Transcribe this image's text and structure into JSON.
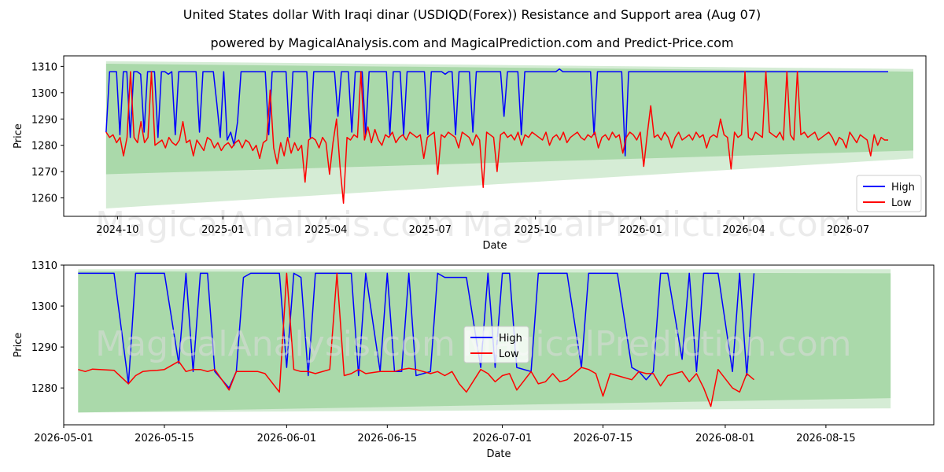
{
  "title": "United States dollar With Iraqi dinar (USDIQD(Forex)) Resistance and Support area (Aug 07)",
  "subtitle": "powered by MagicalAnalysis.com and MagicalPrediction.com and Predict-Price.com",
  "watermarks": [
    "MagicalAnalysis.com",
    "MagicalPrediction.com"
  ],
  "colors": {
    "high": "#0000ff",
    "low": "#ff0000",
    "band": "#2ca02c"
  },
  "chart_data": [
    {
      "type": "line",
      "xlabel": "Date",
      "ylabel": "Price",
      "xlim": [
        "2024-08-15",
        "2026-09-07"
      ],
      "ylim": [
        1253,
        1314
      ],
      "x_ticks": [
        "2024-10",
        "2025-01",
        "2025-04",
        "2025-07",
        "2025-10",
        "2026-01",
        "2026-04",
        "2026-07"
      ],
      "x_tick_dates": [
        "2024-10-01",
        "2025-01-01",
        "2025-04-01",
        "2025-07-01",
        "2025-10-01",
        "2026-01-01",
        "2026-04-01",
        "2026-07-01"
      ],
      "y_ticks": [
        1260,
        1270,
        1280,
        1290,
        1300,
        1310
      ],
      "legend": {
        "position": "lower right",
        "entries": [
          "High",
          "Low"
        ]
      },
      "bands": [
        {
          "x": [
            "2024-09-21",
            "2026-08-27"
          ],
          "upper": [
            1312,
            1309
          ],
          "lower": [
            1256,
            1275
          ],
          "opacity": 0.2
        },
        {
          "x": [
            "2024-09-21",
            "2026-08-27"
          ],
          "upper": [
            1311,
            1308
          ],
          "lower": [
            1269,
            1278
          ],
          "opacity": 0.25
        }
      ],
      "series": [
        {
          "name": "High",
          "start": "2024-09-21",
          "end": "2026-08-05",
          "values": [
            1285,
            1308,
            1308,
            1308,
            1284,
            1308,
            1308,
            1283,
            1308,
            1308,
            1307,
            1285,
            1308,
            1308,
            1308,
            1283,
            1308,
            1308,
            1307,
            1308,
            1284,
            1308,
            1308,
            1308,
            1308,
            1308,
            1308,
            1285,
            1308,
            1308,
            1308,
            1308,
            1296,
            1283,
            1308,
            1282,
            1285,
            1280,
            1289,
            1308,
            1308,
            1308,
            1308,
            1308,
            1308,
            1308,
            1308,
            1284,
            1308,
            1308,
            1308,
            1308,
            1308,
            1283,
            1308,
            1308,
            1308,
            1308,
            1308,
            1283,
            1308,
            1308,
            1308,
            1308,
            1308,
            1308,
            1308,
            1291,
            1308,
            1308,
            1308,
            1285,
            1308,
            1308,
            1308,
            1284,
            1308,
            1308,
            1308,
            1308,
            1308,
            1308,
            1284,
            1308,
            1308,
            1308,
            1284,
            1308,
            1308,
            1308,
            1308,
            1308,
            1308,
            1284,
            1308,
            1308,
            1308,
            1308,
            1307,
            1308,
            1308,
            1284,
            1308,
            1308,
            1308,
            1308,
            1285,
            1308,
            1308,
            1308,
            1308,
            1308,
            1308,
            1308,
            1308,
            1291,
            1308,
            1308,
            1308,
            1308,
            1284,
            1308,
            1308,
            1308,
            1308,
            1308,
            1308,
            1308,
            1308,
            1308,
            1308,
            1309,
            1308,
            1308,
            1308,
            1308,
            1308,
            1308,
            1308,
            1308,
            1308,
            1284,
            1308,
            1308,
            1308,
            1308,
            1308,
            1308,
            1308,
            1308,
            1276,
            1308,
            1308,
            1308,
            1308,
            1308,
            1308,
            1308,
            1308,
            1308,
            1308,
            1308,
            1308,
            1308,
            1308,
            1308,
            1308,
            1308,
            1308,
            1308,
            1308,
            1308,
            1308,
            1308,
            1308,
            1308,
            1308,
            1308,
            1308,
            1308,
            1308,
            1308,
            1308,
            1308,
            1308,
            1308,
            1308,
            1308,
            1308,
            1308,
            1308,
            1308,
            1308,
            1308,
            1308,
            1308,
            1308,
            1308,
            1308,
            1308,
            1308,
            1308,
            1308,
            1308,
            1308,
            1308,
            1308,
            1308,
            1308,
            1308,
            1308,
            1308,
            1308,
            1308,
            1308,
            1308,
            1308,
            1308,
            1308,
            1308,
            1308,
            1308,
            1308,
            1308,
            1308,
            1308,
            1308
          ]
        },
        {
          "name": "Low",
          "start": "2024-09-21",
          "end": "2026-08-05",
          "values": [
            1285,
            1283,
            1284,
            1281,
            1283,
            1276,
            1283,
            1308,
            1283,
            1281,
            1289,
            1281,
            1283,
            1308,
            1280,
            1281,
            1282,
            1279,
            1283,
            1281,
            1280,
            1282,
            1289,
            1281,
            1282,
            1276,
            1282,
            1280,
            1278,
            1283,
            1282,
            1279,
            1281,
            1278,
            1280,
            1281,
            1279,
            1281,
            1282,
            1279,
            1282,
            1281,
            1278,
            1280,
            1275,
            1281,
            1282,
            1301,
            1279,
            1273,
            1281,
            1276,
            1283,
            1277,
            1281,
            1278,
            1280,
            1266,
            1282,
            1283,
            1282,
            1279,
            1283,
            1281,
            1269,
            1281,
            1290,
            1272,
            1258,
            1283,
            1282,
            1284,
            1283,
            1308,
            1282,
            1287,
            1281,
            1286,
            1282,
            1280,
            1284,
            1283,
            1285,
            1281,
            1283,
            1284,
            1282,
            1285,
            1284,
            1283,
            1284,
            1275,
            1283,
            1284,
            1285,
            1269,
            1284,
            1283,
            1285,
            1284,
            1283,
            1279,
            1285,
            1284,
            1283,
            1280,
            1284,
            1282,
            1264,
            1285,
            1284,
            1283,
            1270,
            1284,
            1285,
            1283,
            1284,
            1282,
            1285,
            1280,
            1284,
            1283,
            1285,
            1284,
            1283,
            1282,
            1285,
            1280,
            1283,
            1284,
            1282,
            1285,
            1281,
            1283,
            1284,
            1285,
            1283,
            1282,
            1284,
            1283,
            1285,
            1279,
            1283,
            1284,
            1282,
            1285,
            1283,
            1284,
            1277,
            1283,
            1285,
            1284,
            1282,
            1285,
            1272,
            1284,
            1295,
            1283,
            1284,
            1282,
            1285,
            1283,
            1279,
            1283,
            1285,
            1282,
            1283,
            1284,
            1282,
            1285,
            1283,
            1284,
            1279,
            1283,
            1284,
            1283,
            1290,
            1284,
            1283,
            1271,
            1285,
            1283,
            1284,
            1308,
            1283,
            1282,
            1285,
            1284,
            1283,
            1308,
            1285,
            1284,
            1283,
            1285,
            1282,
            1308,
            1284,
            1282,
            1308,
            1284,
            1285,
            1283,
            1284,
            1285,
            1282,
            1283,
            1284,
            1285,
            1283,
            1280,
            1283,
            1282,
            1279,
            1285,
            1283,
            1281,
            1284,
            1283,
            1282,
            1276,
            1284,
            1280,
            1283,
            1282,
            1282
          ]
        }
      ]
    },
    {
      "type": "line",
      "xlabel": "Date",
      "ylabel": "Price",
      "xlim": [
        "2026-05-01",
        "2026-08-30"
      ],
      "ylim": [
        1271,
        1310
      ],
      "x_ticks": [
        "2026-05-01",
        "2026-05-15",
        "2026-06-01",
        "2026-06-15",
        "2026-07-01",
        "2026-07-15",
        "2026-08-01",
        "2026-08-15"
      ],
      "y_ticks": [
        1280,
        1290,
        1300,
        1310
      ],
      "legend": {
        "position": "center",
        "entries": [
          "High",
          "Low"
        ]
      },
      "bands": [
        {
          "x": [
            "2026-05-03",
            "2026-08-24"
          ],
          "upper": [
            1309,
            1309
          ],
          "lower": [
            1274,
            1275
          ],
          "opacity": 0.2
        },
        {
          "x": [
            "2026-05-03",
            "2026-08-24"
          ],
          "upper": [
            1308.5,
            1308
          ],
          "lower": [
            1274,
            1277.5
          ],
          "opacity": 0.25
        }
      ],
      "series": [
        {
          "name": "High",
          "x": [
            "2026-05-03",
            "2026-05-04",
            "2026-05-05",
            "2026-05-06",
            "2026-05-07",
            "2026-05-08",
            "2026-05-10",
            "2026-05-11",
            "2026-05-12",
            "2026-05-13",
            "2026-05-14",
            "2026-05-15",
            "2026-05-17",
            "2026-05-18",
            "2026-05-19",
            "2026-05-20",
            "2026-05-21",
            "2026-05-22",
            "2026-05-24",
            "2026-05-25",
            "2026-05-26",
            "2026-05-27",
            "2026-05-28",
            "2026-05-29",
            "2026-05-31",
            "2026-06-01",
            "2026-06-02",
            "2026-06-03",
            "2026-06-04",
            "2026-06-05",
            "2026-06-07",
            "2026-06-08",
            "2026-06-09",
            "2026-06-10",
            "2026-06-11",
            "2026-06-12",
            "2026-06-14",
            "2026-06-15",
            "2026-06-16",
            "2026-06-17",
            "2026-06-18",
            "2026-06-19",
            "2026-06-21",
            "2026-06-22",
            "2026-06-23",
            "2026-06-24",
            "2026-06-25",
            "2026-06-26",
            "2026-06-28",
            "2026-06-29",
            "2026-06-30",
            "2026-07-01",
            "2026-07-02",
            "2026-07-03",
            "2026-07-05",
            "2026-07-06",
            "2026-07-07",
            "2026-07-08",
            "2026-07-09",
            "2026-07-10",
            "2026-07-12",
            "2026-07-13",
            "2026-07-14",
            "2026-07-15",
            "2026-07-16",
            "2026-07-17",
            "2026-07-19",
            "2026-07-20",
            "2026-07-21",
            "2026-07-22",
            "2026-07-23",
            "2026-07-24",
            "2026-07-26",
            "2026-07-27",
            "2026-07-28",
            "2026-07-29",
            "2026-07-30",
            "2026-07-31",
            "2026-08-02",
            "2026-08-03",
            "2026-08-04",
            "2026-08-05"
          ],
          "values": [
            1308,
            1308,
            1308,
            1308,
            1308,
            1308,
            1281,
            1308,
            1308,
            1308,
            1308,
            1308,
            1286,
            1308,
            1284,
            1308,
            1308,
            1284,
            1280,
            1284,
            1307,
            1308,
            1308,
            1308,
            1308,
            1285,
            1308,
            1307,
            1283,
            1308,
            1308,
            1308,
            1308,
            1308,
            1283,
            1308,
            1284,
            1308,
            1284,
            1284,
            1308,
            1283,
            1284,
            1308,
            1307,
            1307,
            1307,
            1307,
            1285,
            1308,
            1285,
            1308,
            1308,
            1285,
            1284,
            1308,
            1308,
            1308,
            1308,
            1308,
            1285,
            1308,
            1308,
            1308,
            1308,
            1308,
            1285,
            1284,
            1282,
            1284,
            1308,
            1308,
            1287,
            1308,
            1284,
            1308,
            1308,
            1308,
            1284,
            1308,
            1283,
            1308
          ]
        },
        {
          "name": "Low",
          "x": [
            "2026-05-03",
            "2026-05-04",
            "2026-05-05",
            "2026-05-06",
            "2026-05-07",
            "2026-05-08",
            "2026-05-10",
            "2026-05-11",
            "2026-05-12",
            "2026-05-13",
            "2026-05-14",
            "2026-05-15",
            "2026-05-17",
            "2026-05-18",
            "2026-05-19",
            "2026-05-20",
            "2026-05-21",
            "2026-05-22",
            "2026-05-24",
            "2026-05-25",
            "2026-05-26",
            "2026-05-27",
            "2026-05-28",
            "2026-05-29",
            "2026-05-31",
            "2026-06-01",
            "2026-06-02",
            "2026-06-03",
            "2026-06-04",
            "2026-06-05",
            "2026-06-07",
            "2026-06-08",
            "2026-06-09",
            "2026-06-10",
            "2026-06-11",
            "2026-06-12",
            "2026-06-14",
            "2026-06-15",
            "2026-06-16",
            "2026-06-17",
            "2026-06-18",
            "2026-06-19",
            "2026-06-21",
            "2026-06-22",
            "2026-06-23",
            "2026-06-24",
            "2026-06-25",
            "2026-06-26",
            "2026-06-28",
            "2026-06-29",
            "2026-06-30",
            "2026-07-01",
            "2026-07-02",
            "2026-07-03",
            "2026-07-05",
            "2026-07-06",
            "2026-07-07",
            "2026-07-08",
            "2026-07-09",
            "2026-07-10",
            "2026-07-12",
            "2026-07-13",
            "2026-07-14",
            "2026-07-15",
            "2026-07-16",
            "2026-07-17",
            "2026-07-19",
            "2026-07-20",
            "2026-07-21",
            "2026-07-22",
            "2026-07-23",
            "2026-07-24",
            "2026-07-26",
            "2026-07-27",
            "2026-07-28",
            "2026-07-29",
            "2026-07-30",
            "2026-07-31",
            "2026-08-02",
            "2026-08-03",
            "2026-08-04",
            "2026-08-05"
          ],
          "values": [
            1284.5,
            1284,
            1284.6,
            1284.5,
            1284.4,
            1284.3,
            1281,
            1283,
            1284,
            1284.2,
            1284.3,
            1284.5,
            1286.5,
            1284,
            1284.5,
            1284.5,
            1284,
            1284.5,
            1279.5,
            1284,
            1284,
            1284,
            1284,
            1283.5,
            1279,
            1308,
            1284.5,
            1284,
            1284,
            1283.5,
            1284.5,
            1308,
            1283,
            1283.5,
            1284.5,
            1283.5,
            1284,
            1284,
            1284,
            1284.5,
            1284.8,
            1284.5,
            1283.5,
            1284,
            1283,
            1284,
            1281,
            1279,
            1284.5,
            1283.5,
            1281.5,
            1283,
            1283.5,
            1279.5,
            1284,
            1281,
            1281.5,
            1283.5,
            1281.5,
            1282,
            1285,
            1284.5,
            1283.5,
            1278,
            1283.5,
            1283,
            1282,
            1284,
            1283.5,
            1283.5,
            1280.5,
            1283,
            1284,
            1281.5,
            1283.5,
            1280,
            1275.5,
            1284.5,
            1280,
            1279,
            1283.5,
            1282
          ]
        }
      ]
    }
  ]
}
